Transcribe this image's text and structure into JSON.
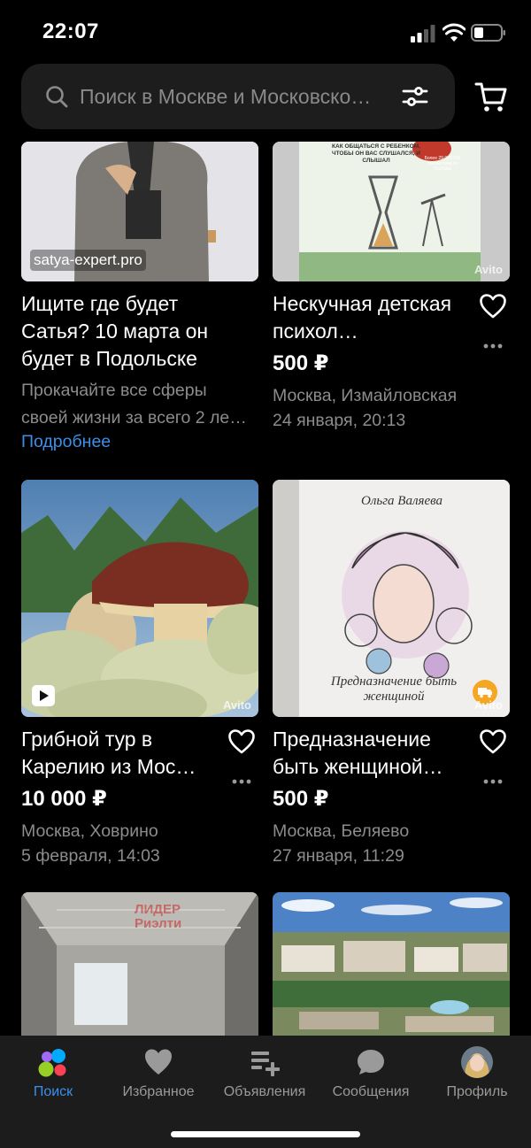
{
  "status_bar": {
    "time": "22:07"
  },
  "search": {
    "placeholder": "Поиск в Москве и Московско…"
  },
  "listings": [
    {
      "title": "Ищите где будет Сатья? 10 марта он будет в Подольске",
      "image_caption": "satya-expert.pro",
      "description": "Прокачайте все сферы своей жизни за всего 2 ле…",
      "link_label": "Подробнее"
    },
    {
      "title": "Нескучная детская психол…",
      "price": "500 ₽",
      "location": "Москва, Измайловская",
      "date": "24 января, 20:13",
      "image_watermark": "Avito",
      "book_cover_text": "КАК ОБЩАТЬСЯ С РЕБЕНКОМ, ЧТОБЫ ОН ВАС СЛУШАЛСЯ, И СЛЫШАЛ",
      "book_badge": "Более 29 000 000 просмотров на YouTube"
    },
    {
      "title": "Грибной тур в Карелию из Мос…",
      "price": "10 000 ₽",
      "location": "Москва, Ховрино",
      "date": "5 февраля, 14:03",
      "image_watermark": "Avito"
    },
    {
      "title": "Предназначение быть женщиной…",
      "price": "500 ₽",
      "location": "Москва, Беляево",
      "date": "27 января, 11:29",
      "image_watermark": "Avito",
      "book_author": "Ольга Валяева",
      "book_title_art": "Предназначение быть женщиной"
    },
    {
      "image_watermark": "ЛИДЕР Риэлти"
    },
    {}
  ],
  "tabs": [
    {
      "label": "Поиск",
      "active": true
    },
    {
      "label": "Избранное"
    },
    {
      "label": "Объявления"
    },
    {
      "label": "Сообщения"
    },
    {
      "label": "Профиль"
    }
  ],
  "colors": {
    "accent": "#3b8fea",
    "background": "#000000",
    "tabbar": "#1c1c1c"
  }
}
